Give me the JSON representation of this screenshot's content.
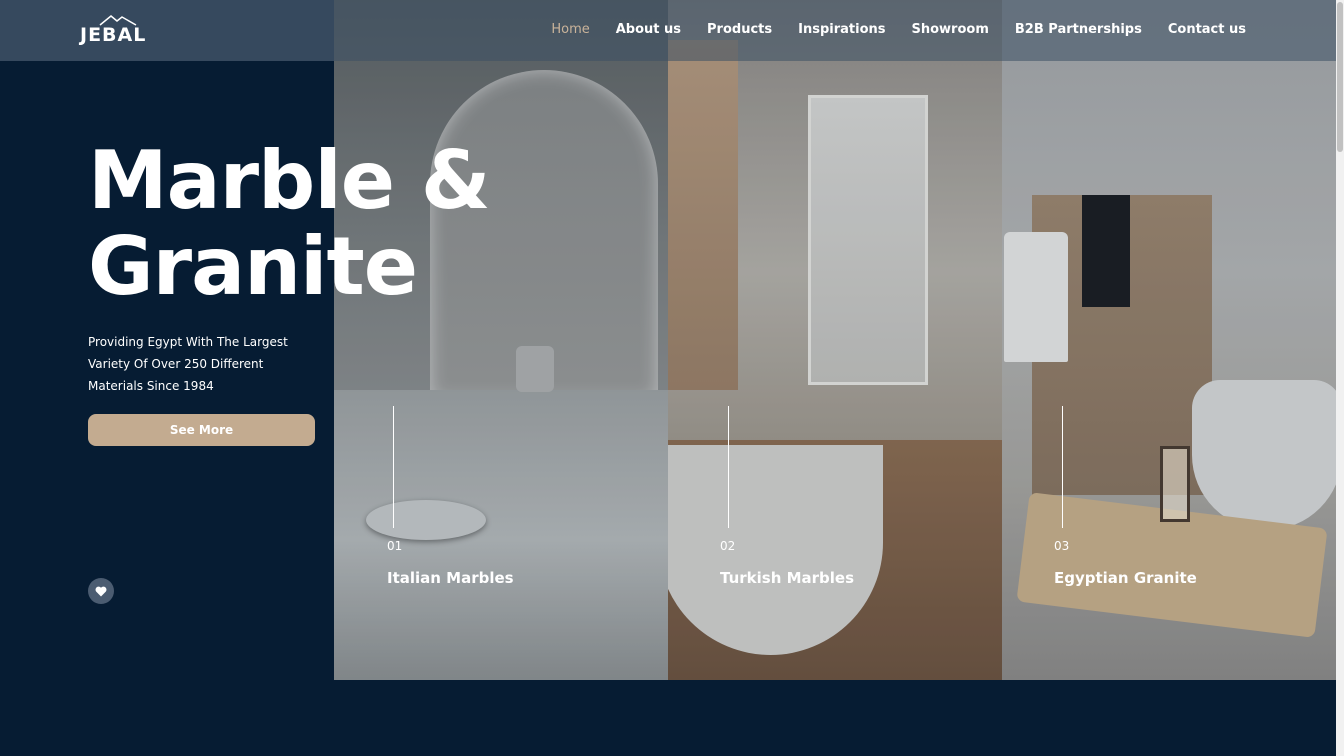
{
  "brand": {
    "logo_text": "JEBAL"
  },
  "nav": {
    "items": [
      {
        "label": "Home",
        "active": true
      },
      {
        "label": "About us"
      },
      {
        "label": "Products"
      },
      {
        "label": "Inspirations"
      },
      {
        "label": "Showroom"
      },
      {
        "label": "B2B Partnerships"
      },
      {
        "label": "Contact us"
      }
    ]
  },
  "hero": {
    "title_line1": "Marble &",
    "title_line2": "Granite",
    "subtitle": "Providing Egypt With The Largest Variety Of Over 250 Different Materials Since 1984",
    "cta_label": "See More"
  },
  "categories": [
    {
      "number": "01",
      "name": "Italian Marbles"
    },
    {
      "number": "02",
      "name": "Turkish Marbles"
    },
    {
      "number": "03",
      "name": "Egyptian Granite"
    }
  ],
  "colors": {
    "background": "#061c33",
    "accent": "#c3ab90",
    "active_nav": "#c9b39a"
  },
  "icons": {
    "favorite": "heart-icon",
    "logo_mark": "mountain-icon"
  }
}
